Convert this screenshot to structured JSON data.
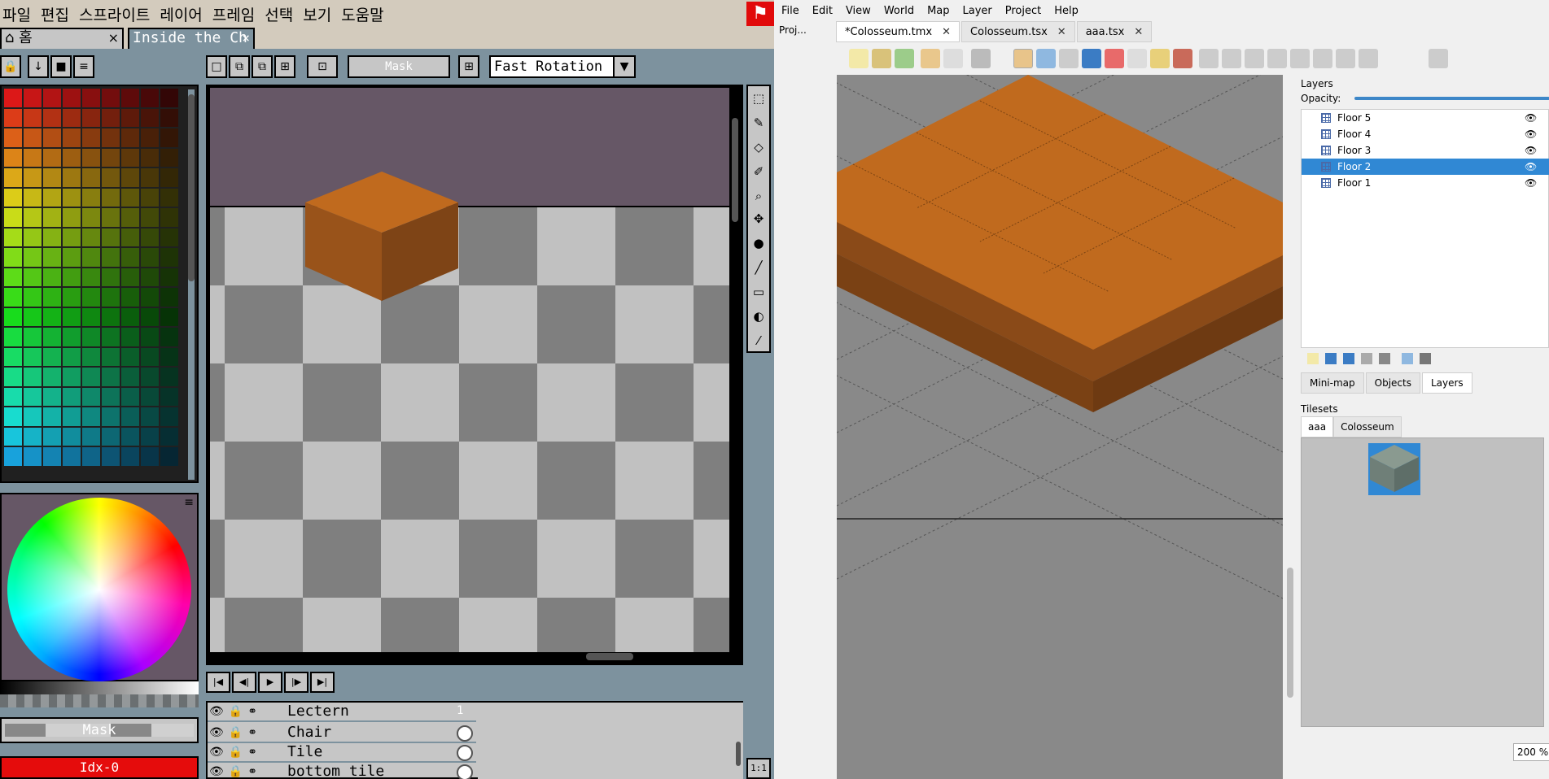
{
  "aseprite": {
    "menu": [
      "파일",
      "편집",
      "스프라이트",
      "레이어",
      "프레임",
      "선택",
      "보기",
      "도움말"
    ],
    "tabs": {
      "home": "홈",
      "doc": "Inside the Ch",
      "close": "×"
    },
    "toolbar": {
      "mask_label": "Mask",
      "rotation_value": "Fast Rotation"
    },
    "mask_button": "Mask",
    "index_label": "Idx-0",
    "frame_number": "1",
    "zoom_label": "1:1",
    "layers": [
      {
        "name": "Lectern"
      },
      {
        "name": "Chair"
      },
      {
        "name": "Tile"
      },
      {
        "name": "bottom tile"
      }
    ],
    "colors": {
      "bg": "#7d929e",
      "panel": "#c6c6c6",
      "menu": "#d3cbbd",
      "accent_red": "#e50c0c",
      "canvas_top": "#665766",
      "tile_orange": "#b7651e"
    }
  },
  "tiled": {
    "menu": [
      "File",
      "Edit",
      "View",
      "World",
      "Map",
      "Layer",
      "Project",
      "Help"
    ],
    "left_tab": "Proj...",
    "doc_tabs": [
      {
        "label": "*Colosseum.tmx",
        "active": true
      },
      {
        "label": "Colosseum.tsx",
        "active": false
      },
      {
        "label": "aaa.tsx",
        "active": false
      }
    ],
    "layers_panel": {
      "title": "Layers",
      "opacity_label": "Opacity:",
      "layers": [
        {
          "name": "Floor 5",
          "selected": false
        },
        {
          "name": "Floor 4",
          "selected": false
        },
        {
          "name": "Floor 3",
          "selected": false
        },
        {
          "name": "Floor 2",
          "selected": true
        },
        {
          "name": "Floor 1",
          "selected": false
        }
      ]
    },
    "dock_tabs": [
      "Mini-map",
      "Objects",
      "Layers"
    ],
    "active_dock_tab": "Layers",
    "tilesets_title": "Tilesets",
    "tileset_tabs": [
      "aaa",
      "Colosseum"
    ],
    "zoom": "200 %",
    "colors": {
      "selection": "#3088d4",
      "map_bg": "#898989",
      "tile_orange": "#c06a1e"
    }
  }
}
